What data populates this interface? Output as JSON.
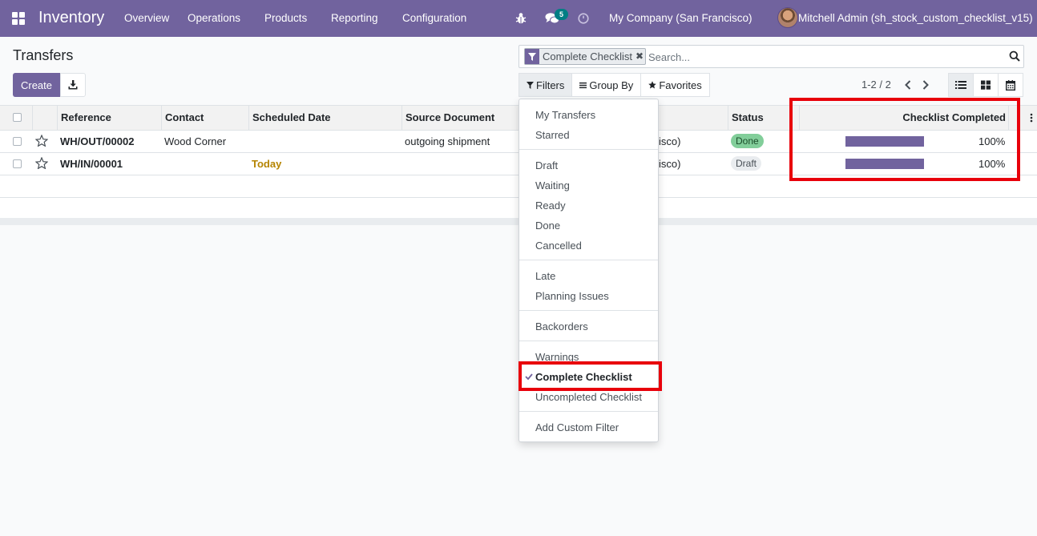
{
  "navbar": {
    "app_name": "Inventory",
    "menu": [
      "Overview",
      "Operations",
      "Products",
      "Reporting",
      "Configuration"
    ],
    "chat_count": "5",
    "company": "My Company (San Francisco)",
    "user": "Mitchell Admin (sh_stock_custom_checklist_v15)"
  },
  "control_panel": {
    "title": "Transfers",
    "create_label": "Create",
    "facet_label": "Complete Checklist",
    "search_placeholder": "Search...",
    "filters_label": "Filters",
    "groupby_label": "Group By",
    "favorites_label": "Favorites",
    "pager": "1-2 / 2"
  },
  "table": {
    "columns": [
      "Reference",
      "Contact",
      "Scheduled Date",
      "Source Document",
      "Status",
      "Checklist Completed"
    ],
    "rows": [
      {
        "reference": "WH/OUT/00002",
        "contact": "Wood Corner",
        "scheduled": "",
        "source": "outgoing shipment",
        "location_tail": "isco)",
        "status": "Done",
        "checklist": "100%",
        "checklist_value": 100
      },
      {
        "reference": "WH/IN/00001",
        "contact": "",
        "scheduled": "Today",
        "source": "",
        "location_tail": "isco)",
        "status": "Draft",
        "checklist": "100%",
        "checklist_value": 100
      }
    ]
  },
  "filters_dropdown": {
    "group1": [
      "My Transfers",
      "Starred"
    ],
    "group2": [
      "Draft",
      "Waiting",
      "Ready",
      "Done",
      "Cancelled"
    ],
    "group3": [
      "Late",
      "Planning Issues"
    ],
    "group4": [
      "Backorders"
    ],
    "group5": [
      "Warnings",
      "Complete Checklist",
      "Uncompleted Checklist"
    ],
    "custom": "Add Custom Filter"
  },
  "colors": {
    "brand": "#71639e",
    "highlight": "#e8000b",
    "today": "#b58400"
  }
}
